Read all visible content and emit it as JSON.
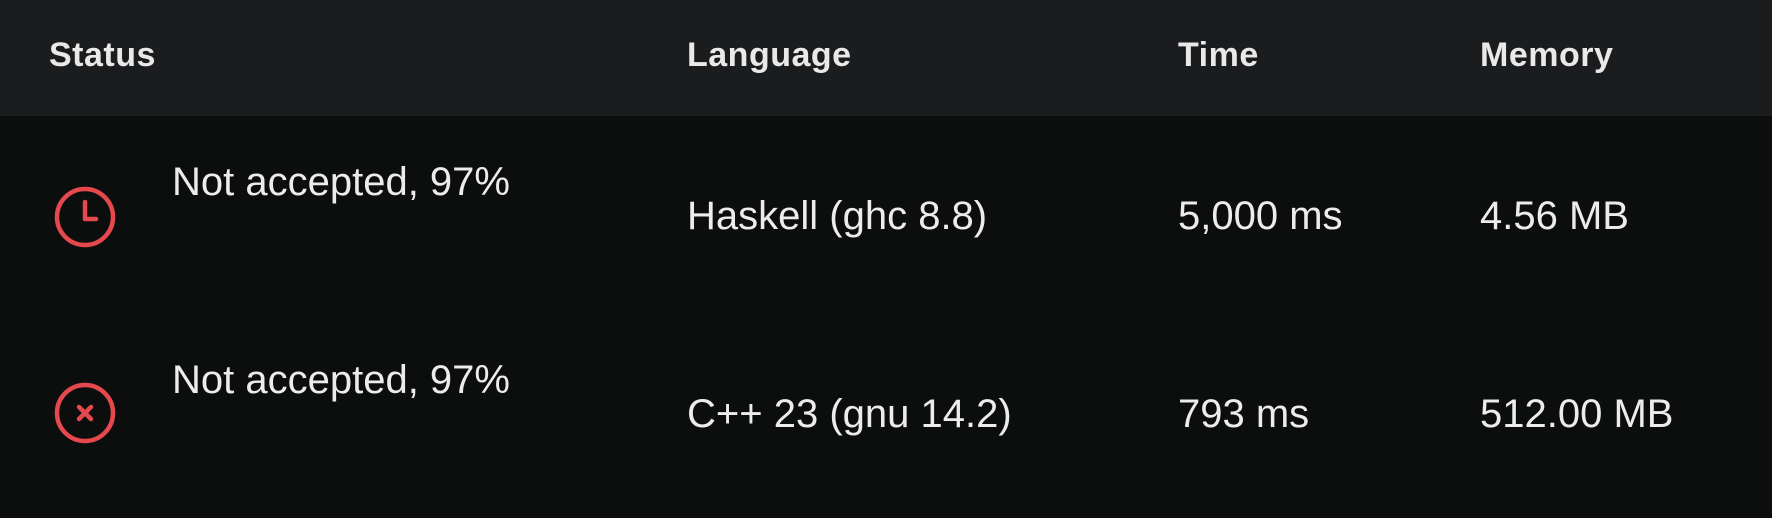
{
  "header": {
    "status": "Status",
    "language": "Language",
    "time": "Time",
    "memory": "Memory"
  },
  "rows": [
    {
      "status_icon": "clock-icon",
      "status": "Not accepted, 97%",
      "language": "Haskell (ghc 8.8)",
      "time": "5,000 ms",
      "memory": "4.56 MB"
    },
    {
      "status_icon": "x-circle-icon",
      "status": "Not accepted, 97%",
      "language": "C++ 23 (gnu 14.2)",
      "time": "793 ms",
      "memory": "512.00 MB"
    }
  ],
  "colors": {
    "background": "#0c0d0d",
    "header_background": "#1b1c1e",
    "header_text": "#e9e9ea",
    "cell_text": "#ececec",
    "error_red": "#e5484d"
  }
}
